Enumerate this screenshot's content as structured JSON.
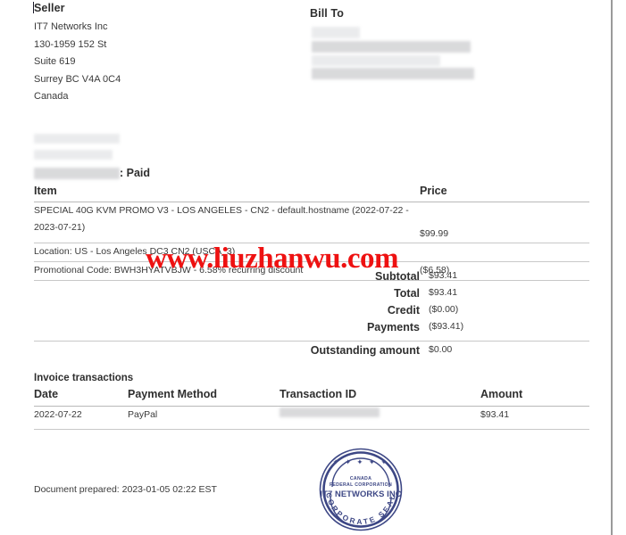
{
  "seller": {
    "heading": "Seller",
    "lines": [
      "IT7 Networks Inc",
      "130-1959 152 St",
      "Suite 619",
      "Surrey BC V4A 0C4",
      "Canada"
    ]
  },
  "bill_to": {
    "heading": "Bill To",
    "redacted": true
  },
  "invoice_meta": {
    "status_label_redacted": true,
    "status_text": ": Paid"
  },
  "items_table": {
    "headers": {
      "item": "Item",
      "price": "Price"
    },
    "rows": [
      {
        "item": "SPECIAL 40G KVM PROMO V3 - LOS ANGELES - CN2 - default.hostname (2022-07-22 - 2023-07-21)",
        "price": "$99.99"
      },
      {
        "item": "Location: US - Los Angeles DC3 CN2 (USCA_3)",
        "price": ""
      },
      {
        "item": "Promotional Code: BWH3HYATVBJW - 6.58% recurring discount",
        "price": "($6.58)"
      }
    ]
  },
  "totals": [
    {
      "label": "Subtotal",
      "value": "$93.41"
    },
    {
      "label": "Total",
      "value": "$93.41"
    },
    {
      "label": "Credit",
      "value": "($0.00)"
    },
    {
      "label": "Payments",
      "value": "($93.41)"
    },
    {
      "label": "Outstanding amount",
      "value": "$0.00"
    }
  ],
  "transactions": {
    "title": "Invoice transactions",
    "headers": {
      "date": "Date",
      "payment_method": "Payment Method",
      "transaction_id": "Transaction ID",
      "amount": "Amount"
    },
    "rows": [
      {
        "date": "2022-07-22",
        "payment_method": "PayPal",
        "transaction_id": "",
        "amount": "$93.41"
      }
    ]
  },
  "footer": {
    "prepared": "Document prepared: 2023-01-05 02:22 EST"
  },
  "seal": {
    "top_text": "CANADA",
    "sub_text": "FEDERAL CORPORATION",
    "company": "IT7 NETWORKS INC",
    "bottom_text": "CORPORATE SEAL",
    "color": "#3d4785",
    "stars": "✶ ✶ ✶ ✶ ✶"
  },
  "watermark": {
    "text": "www.liuzhanwu.com",
    "color": "#ee1111"
  }
}
